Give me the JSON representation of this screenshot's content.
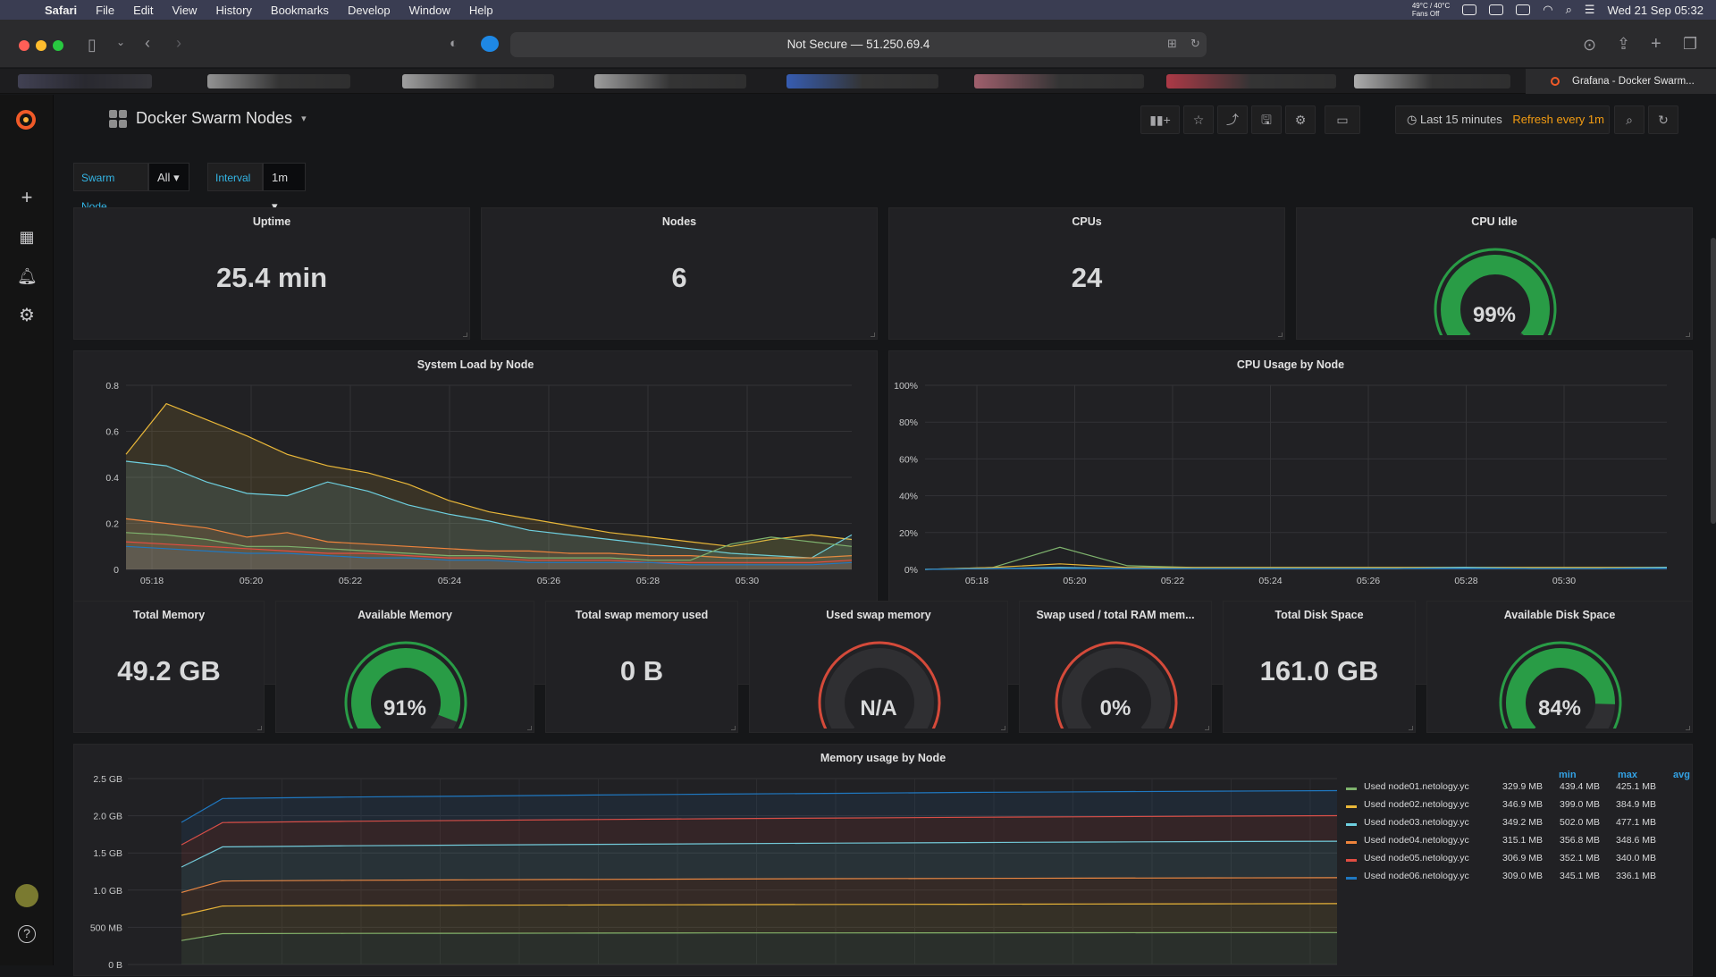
{
  "mac_menu": {
    "items": [
      "Safari",
      "File",
      "Edit",
      "View",
      "History",
      "Bookmarks",
      "Develop",
      "Window",
      "Help"
    ],
    "temps_top": "49°C / 40°C",
    "temps_bottom": "Fans Off",
    "datetime": "Wed 21 Sep  05:32"
  },
  "browser": {
    "url": "Not Secure — 51.250.69.4",
    "active_tab": "Grafana - Docker Swarm..."
  },
  "dashboard": {
    "title": "Docker Swarm Nodes",
    "time_range": "Last 15 minutes",
    "refresh": "Refresh every 1m"
  },
  "variables": [
    {
      "label": "Swarm Node",
      "value": "All"
    },
    {
      "label": "Interval",
      "value": "1m"
    }
  ],
  "stats": {
    "uptime": {
      "title": "Uptime",
      "value": "25.4 min"
    },
    "nodes": {
      "title": "Nodes",
      "value": "6"
    },
    "cpus": {
      "title": "CPUs",
      "value": "24"
    },
    "cpu_idle": {
      "title": "CPU Idle",
      "value": "99%",
      "level": 0.99
    },
    "total_memory": {
      "title": "Total Memory",
      "value": "49.2 GB"
    },
    "available_memory": {
      "title": "Available Memory",
      "value": "91%",
      "level": 0.91
    },
    "total_swap": {
      "title": "Total swap memory used",
      "value": "0 B"
    },
    "used_swap": {
      "title": "Used swap memory",
      "value": "N/A",
      "level": 0
    },
    "swap_ratio": {
      "title": "Swap used / total RAM mem...",
      "value": "0%",
      "level": 0
    },
    "total_disk": {
      "title": "Total Disk Space",
      "value": "161.0 GB"
    },
    "available_disk": {
      "title": "Available Disk Space",
      "value": "84%",
      "level": 0.84
    }
  },
  "colors": {
    "gauge_green": "#299c46",
    "gauge_orange": "#ed8128",
    "gauge_red": "#d44a3a",
    "accent_blue": "#33b5e5",
    "refresh_orange": "#f39c12"
  },
  "chart_data": [
    {
      "type": "area",
      "title": "System Load by Node",
      "x": [
        "05:17",
        "05:17:30",
        "05:18",
        "05:19",
        "05:20",
        "05:20:30",
        "05:21",
        "05:22",
        "05:23",
        "05:24",
        "05:25",
        "05:26",
        "05:27",
        "05:28",
        "05:29",
        "05:30",
        "05:30:30",
        "05:31",
        "05:32"
      ],
      "xticks": [
        "05:18",
        "05:20",
        "05:22",
        "05:24",
        "05:26",
        "05:28",
        "05:30"
      ],
      "ylim": [
        0,
        0.8
      ],
      "yticks": [
        "0",
        "0.2",
        "0.4",
        "0.6",
        "0.8"
      ],
      "series": [
        {
          "color": "#eab839",
          "values": [
            0.5,
            0.72,
            0.65,
            0.58,
            0.5,
            0.45,
            0.42,
            0.37,
            0.3,
            0.25,
            0.22,
            0.19,
            0.16,
            0.14,
            0.12,
            0.1,
            0.13,
            0.15,
            0.13
          ]
        },
        {
          "color": "#6ed0e0",
          "values": [
            0.47,
            0.45,
            0.38,
            0.33,
            0.32,
            0.38,
            0.34,
            0.28,
            0.24,
            0.21,
            0.17,
            0.15,
            0.13,
            0.11,
            0.09,
            0.07,
            0.06,
            0.05,
            0.15
          ]
        },
        {
          "color": "#ef843c",
          "values": [
            0.22,
            0.2,
            0.18,
            0.14,
            0.16,
            0.12,
            0.11,
            0.1,
            0.09,
            0.08,
            0.08,
            0.07,
            0.07,
            0.06,
            0.06,
            0.05,
            0.05,
            0.05,
            0.06
          ]
        },
        {
          "color": "#7eb26d",
          "values": [
            0.16,
            0.15,
            0.13,
            0.1,
            0.1,
            0.09,
            0.08,
            0.07,
            0.06,
            0.06,
            0.05,
            0.05,
            0.05,
            0.04,
            0.04,
            0.11,
            0.14,
            0.12,
            0.1
          ]
        },
        {
          "color": "#e24d42",
          "values": [
            0.12,
            0.11,
            0.1,
            0.09,
            0.08,
            0.07,
            0.07,
            0.06,
            0.05,
            0.05,
            0.04,
            0.04,
            0.04,
            0.03,
            0.03,
            0.03,
            0.03,
            0.03,
            0.04
          ]
        },
        {
          "color": "#1f78c1",
          "values": [
            0.1,
            0.09,
            0.08,
            0.07,
            0.07,
            0.06,
            0.05,
            0.05,
            0.04,
            0.04,
            0.03,
            0.03,
            0.03,
            0.03,
            0.02,
            0.02,
            0.02,
            0.02,
            0.03
          ]
        }
      ]
    },
    {
      "type": "line",
      "title": "CPU Usage by Node",
      "x": [
        "05:17",
        "05:17:30",
        "05:18",
        "05:18:30",
        "05:19",
        "05:20",
        "05:22",
        "05:24",
        "05:26",
        "05:28",
        "05:30",
        "05:32"
      ],
      "xticks": [
        "05:18",
        "05:20",
        "05:22",
        "05:24",
        "05:26",
        "05:28",
        "05:30"
      ],
      "ylim": [
        0,
        100
      ],
      "yticks": [
        "0%",
        "20%",
        "40%",
        "60%",
        "80%",
        "100%"
      ],
      "series": [
        {
          "color": "#7eb26d",
          "values": [
            0,
            1,
            12,
            2,
            1,
            1,
            1,
            1,
            1,
            1,
            1,
            1
          ]
        },
        {
          "color": "#eab839",
          "values": [
            0,
            1,
            3,
            1,
            1,
            1,
            1,
            1,
            1,
            1,
            1,
            1
          ]
        },
        {
          "color": "#6ed0e0",
          "values": [
            0,
            0.5,
            1,
            0.5,
            0.5,
            0.5,
            0.5,
            0.5,
            1,
            0.5,
            0.5,
            1
          ]
        },
        {
          "color": "#1f78c1",
          "values": [
            0,
            0.5,
            0.5,
            0.5,
            0.5,
            0.5,
            0.5,
            0.5,
            0.5,
            0.5,
            0.5,
            0.5
          ]
        }
      ]
    },
    {
      "type": "area",
      "title": "Memory usage by Node",
      "ylim_bytes_mb": [
        0,
        2560
      ],
      "yticks": [
        "0 B",
        "500 MB",
        "1.0 GB",
        "1.5 GB",
        "2.0 GB",
        "2.5 GB"
      ],
      "legend_columns": [
        "min",
        "max",
        "avg"
      ],
      "series": [
        {
          "name": "Used node01.netology.yc",
          "color": "#7eb26d",
          "values": [
            330,
            425,
            428,
            430,
            432,
            434,
            435,
            436,
            437,
            438,
            439
          ],
          "min": "329.9 MB",
          "max": "439.4 MB",
          "avg": "425.1 MB"
        },
        {
          "name": "Used node02.netology.yc",
          "color": "#eab839",
          "values": [
            347,
            380,
            384,
            386,
            388,
            390,
            392,
            394,
            396,
            398,
            399
          ],
          "min": "346.9 MB",
          "max": "399.0 MB",
          "avg": "384.9 MB"
        },
        {
          "name": "Used node03.netology.yc",
          "color": "#6ed0e0",
          "values": [
            349,
            470,
            474,
            478,
            482,
            486,
            490,
            494,
            497,
            500,
            502
          ],
          "min": "349.2 MB",
          "max": "502.0 MB",
          "avg": "477.1 MB"
        },
        {
          "name": "Used node04.netology.yc",
          "color": "#ef843c",
          "values": [
            315,
            345,
            348,
            350,
            352,
            353,
            354,
            355,
            356,
            356,
            357
          ],
          "min": "315.1 MB",
          "max": "356.8 MB",
          "avg": "348.6 MB"
        },
        {
          "name": "Used node05.netology.yc",
          "color": "#e24d42",
          "values": [
            307,
            335,
            338,
            340,
            342,
            344,
            346,
            348,
            349,
            351,
            352
          ],
          "min": "306.9 MB",
          "max": "352.1 MB",
          "avg": "340.0 MB"
        },
        {
          "name": "Used node06.netology.yc",
          "color": "#1f78c1",
          "values": [
            309,
            330,
            333,
            335,
            337,
            339,
            340,
            342,
            343,
            344,
            345
          ],
          "min": "309.0 MB",
          "max": "345.1 MB",
          "avg": "336.1 MB"
        }
      ]
    }
  ]
}
